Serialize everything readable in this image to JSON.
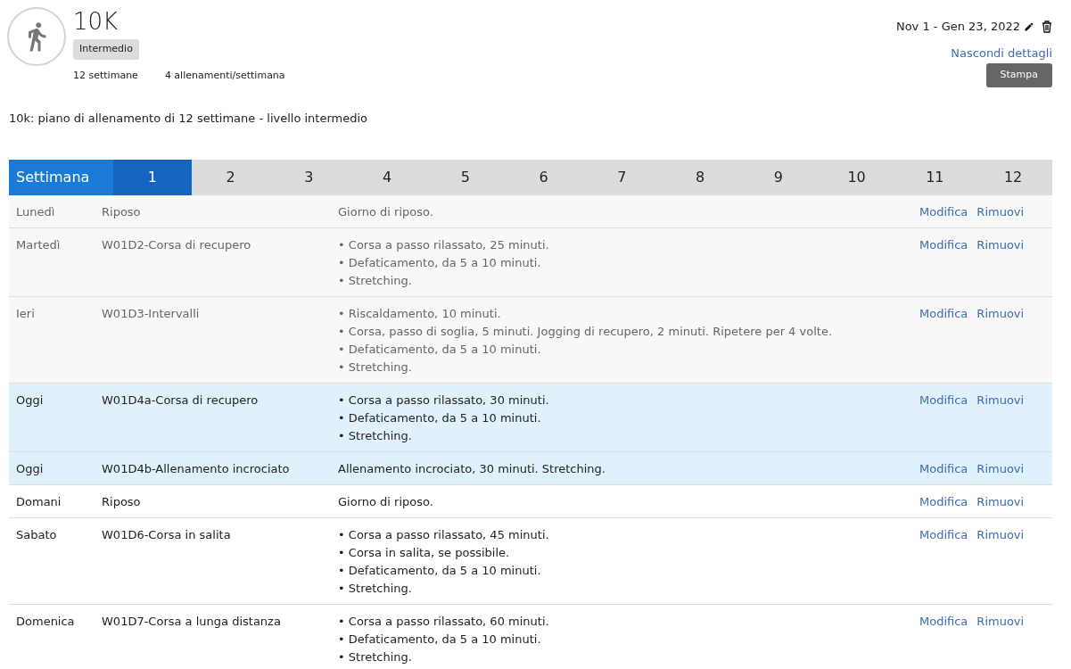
{
  "plan": {
    "title": "10K",
    "level": "Intermedio",
    "duration": "12 settimane",
    "frequency": "4 allenamenti/settimana",
    "dates": "Nov 1 - Gen 23, 2022",
    "toggle_link": "Nascondi dettagli",
    "print_button": "Stampa",
    "description": "10k: piano di allenamento di 12 settimane - livello intermedio"
  },
  "weeks": {
    "label": "Settimana",
    "items": [
      {
        "label": "1",
        "selected": true
      },
      {
        "label": "2",
        "selected": false
      },
      {
        "label": "3",
        "selected": false
      },
      {
        "label": "4",
        "selected": false
      },
      {
        "label": "5",
        "selected": false
      },
      {
        "label": "6",
        "selected": false
      },
      {
        "label": "7",
        "selected": false
      },
      {
        "label": "8",
        "selected": false
      },
      {
        "label": "9",
        "selected": false
      },
      {
        "label": "10",
        "selected": false
      },
      {
        "label": "11",
        "selected": false
      },
      {
        "label": "12",
        "selected": false
      }
    ]
  },
  "rows": [
    {
      "kind": "past",
      "day": "Lunedì",
      "workout": "Riposo",
      "details": [
        "Giorno di riposo."
      ],
      "edit": "Modifica",
      "remove": "Rimuovi"
    },
    {
      "kind": "past",
      "day": "Martedì",
      "workout": "W01D2-Corsa di recupero",
      "details": [
        "• Corsa a passo rilassato, 25 minuti.",
        "• Defaticamento, da 5 a 10 minuti.",
        "• Stretching."
      ],
      "edit": "Modifica",
      "remove": "Rimuovi"
    },
    {
      "kind": "past",
      "day": "Ieri",
      "workout": "W01D3-Intervalli",
      "details": [
        "• Riscaldamento, 10 minuti.",
        "• Corsa, passo di soglia, 5 minuti. Jogging di recupero, 2 minuti. Ripetere per 4 volte.",
        "• Defaticamento, da 5 a 10 minuti.",
        "• Stretching."
      ],
      "edit": "Modifica",
      "remove": "Rimuovi"
    },
    {
      "kind": "today",
      "day": "Oggi",
      "workout": "W01D4a-Corsa di recupero",
      "details": [
        "• Corsa a passo rilassato, 30 minuti.",
        "• Defaticamento, da 5 a 10 minuti.",
        "• Stretching."
      ],
      "edit": "Modifica",
      "remove": "Rimuovi"
    },
    {
      "kind": "today",
      "day": "Oggi",
      "workout": "W01D4b-Allenamento incrociato",
      "details": [
        "Allenamento incrociato, 30 minuti. Stretching."
      ],
      "edit": "Modifica",
      "remove": "Rimuovi"
    },
    {
      "kind": "future",
      "day": "Domani",
      "workout": "Riposo",
      "details": [
        "Giorno di riposo."
      ],
      "edit": "Modifica",
      "remove": "Rimuovi"
    },
    {
      "kind": "future",
      "day": "Sabato",
      "workout": "W01D6-Corsa in salita",
      "details": [
        "• Corsa a passo rilassato, 45 minuti.",
        "• Corsa in salita, se possibile.",
        "• Defaticamento, da 5 a 10 minuti.",
        "• Stretching."
      ],
      "edit": "Modifica",
      "remove": "Rimuovi"
    },
    {
      "kind": "future",
      "day": "Domenica",
      "workout": "W01D7-Corsa a lunga distanza",
      "details": [
        "• Corsa a passo rilassato, 60 minuti.",
        "• Defaticamento, da 5 a 10 minuti.",
        "• Stretching."
      ],
      "edit": "Modifica",
      "remove": "Rimuovi"
    }
  ]
}
